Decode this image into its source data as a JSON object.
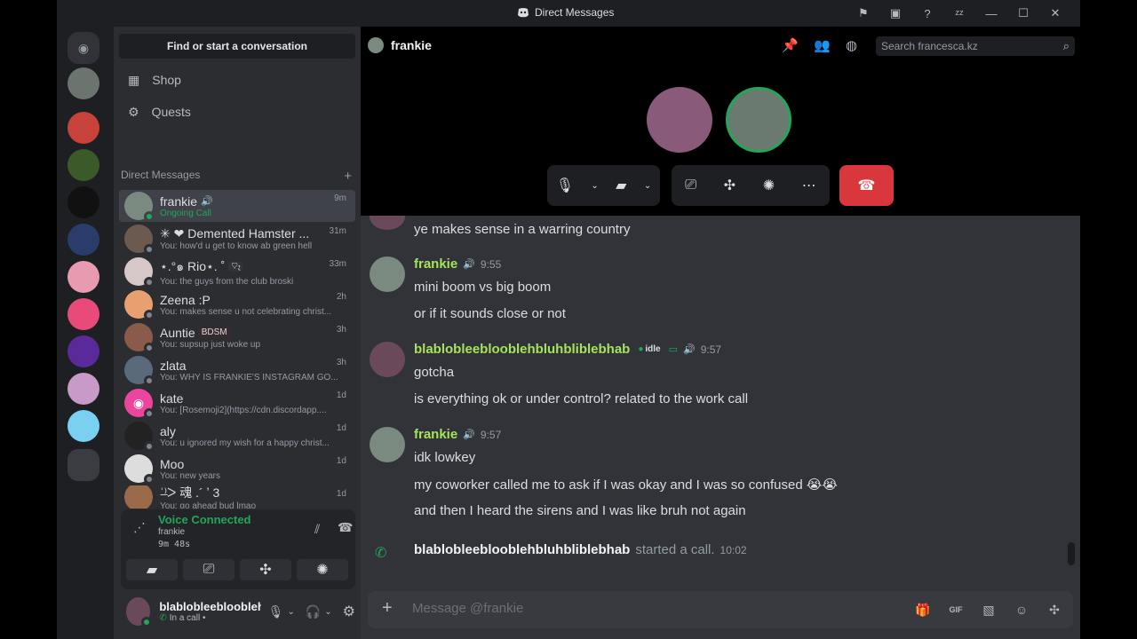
{
  "window": {
    "title": "Direct Messages"
  },
  "sidebar": {
    "find_label": "Find or start a conversation",
    "nav": [
      {
        "label": "Shop",
        "icon": "shop-icon"
      },
      {
        "label": "Quests",
        "icon": "quests-icon"
      }
    ],
    "dm_header": "Direct Messages",
    "dms": [
      {
        "name": "frankie",
        "sub": "Ongoing Call",
        "time": "9m",
        "active": true
      },
      {
        "name": "✳ ❤ Demented Hamster ...",
        "sub": "You: how'd u get to know ab green hell",
        "time": "31m"
      },
      {
        "name": "⋆.°๑ Rio⋆. ˚",
        "tag": "♡ෑ",
        "sub": "You: the guys from the club broski",
        "time": "33m"
      },
      {
        "name": "Zeena :P",
        "sub": "You: makes sense u not celebrating christ...",
        "time": "2h"
      },
      {
        "name": "Auntie",
        "tag": "BDSM",
        "sub": "You: supsup just woke up",
        "time": "3h"
      },
      {
        "name": "zlata",
        "sub": "You: WHY IS FRANKIE'S INSTAGRAM GO...",
        "time": "3h"
      },
      {
        "name": "kate",
        "sub": "You: [Rosemoji2](https://cdn.discordapp....",
        "time": "1d"
      },
      {
        "name": "aly",
        "sub": "You: u ignored my wish for a happy christ...",
        "time": "1d"
      },
      {
        "name": "Moo",
        "sub": "You: new years",
        "time": "1d"
      },
      {
        "name": "ʿ̶⁾ᐳ 魂 .´ ʼ 3",
        "sub": "You: go ahead bud lmao",
        "time": "1d"
      }
    ],
    "voice": {
      "title": "Voice Connected",
      "channel": "frankie",
      "duration": "9m 48s"
    },
    "user": {
      "name": "blablobleeblooblehbl...",
      "status": "In a call •"
    }
  },
  "chat": {
    "recipient": "frankie",
    "search_placeholder": "Search francesca.kz",
    "composer_placeholder": "Message @frankie",
    "messages": {
      "prev_line": "ye makes sense in a warring country",
      "g1": {
        "author": "frankie",
        "time": "9:55",
        "lines": [
          "mini boom vs big boom",
          "or if it sounds close or not"
        ]
      },
      "g2": {
        "author": "blablobleeblooblehbluhbliblebhab",
        "status": "idle",
        "time": "9:57",
        "lines": [
          "gotcha",
          "is everything ok or under control? related to the work call"
        ]
      },
      "g3": {
        "author": "frankie",
        "time": "9:57",
        "lines": [
          "idk lowkey",
          "my coworker called me to ask if I was okay and I was so confused 😭😭",
          "and then I heard the sirens and I was like bruh not again"
        ]
      },
      "call": {
        "author": "blablobleeblooblehbluhbliblebhab",
        "text": "started a call.",
        "time": "10:02"
      }
    }
  },
  "colors": {
    "accent_green": "#23a55a",
    "name_green": "#a6e35a",
    "hangup_red": "#da373c",
    "blurple": "#5865f2"
  }
}
